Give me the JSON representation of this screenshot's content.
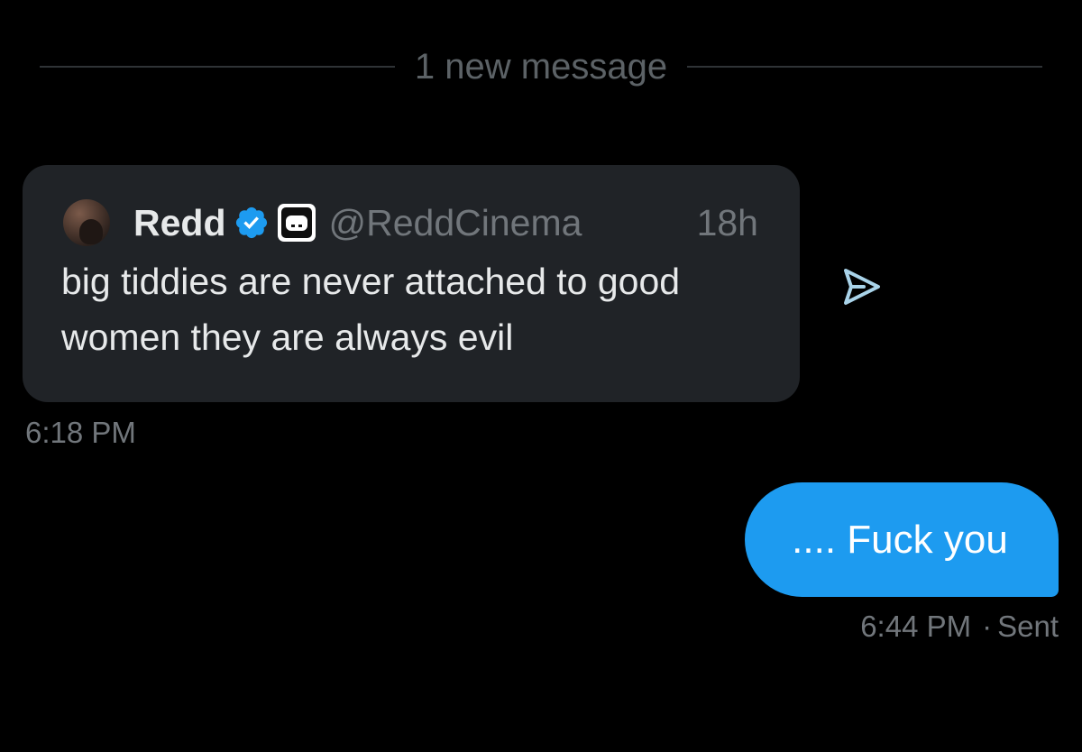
{
  "divider": {
    "label": "1 new message"
  },
  "quoted_tweet": {
    "author_name": "Redd",
    "handle": "@ReddCinema",
    "time_ago": "18h",
    "text": "big tiddies are never attached to good women they are always evil",
    "icons": {
      "verified": "verified-badge-icon",
      "affiliate": "affiliate-badge-icon",
      "avatar": "avatar"
    },
    "colors": {
      "bubble_bg": "#202327",
      "verified": "#1d9bf0"
    }
  },
  "received_message": {
    "timestamp": "6:18 PM",
    "share_icon": "share-icon"
  },
  "sent_message": {
    "text": ".... Fuck you",
    "timestamp": "6:44 PM",
    "separator": "·",
    "status": "Sent",
    "bubble_color": "#1d9bf0"
  }
}
